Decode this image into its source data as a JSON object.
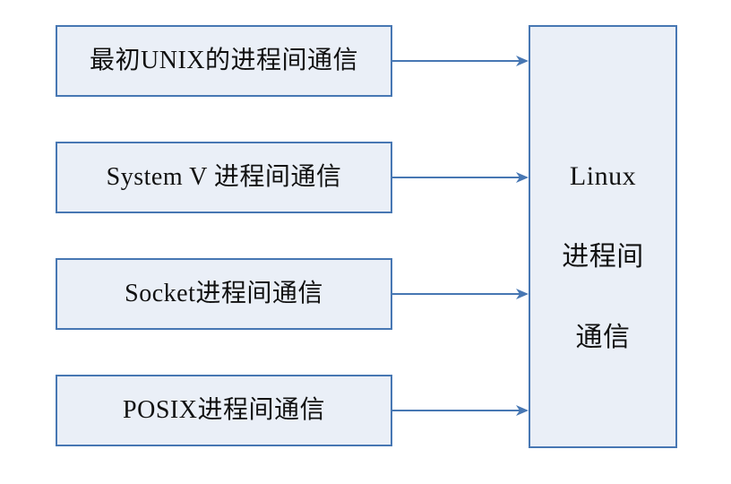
{
  "diagram": {
    "sources": [
      {
        "label": "最初UNIX的进程间通信"
      },
      {
        "label": "System V 进程间通信"
      },
      {
        "label": "Socket进程间通信"
      },
      {
        "label": "POSIX进程间通信"
      }
    ],
    "target": {
      "label_line1": "Linux",
      "label_line2": "进程间",
      "label_line3": "通信"
    },
    "relation": "arrows-from-each-source-to-target",
    "colors": {
      "box_fill": "#eaeff7",
      "box_border": "#4777b3",
      "arrow": "#4777b3"
    }
  }
}
